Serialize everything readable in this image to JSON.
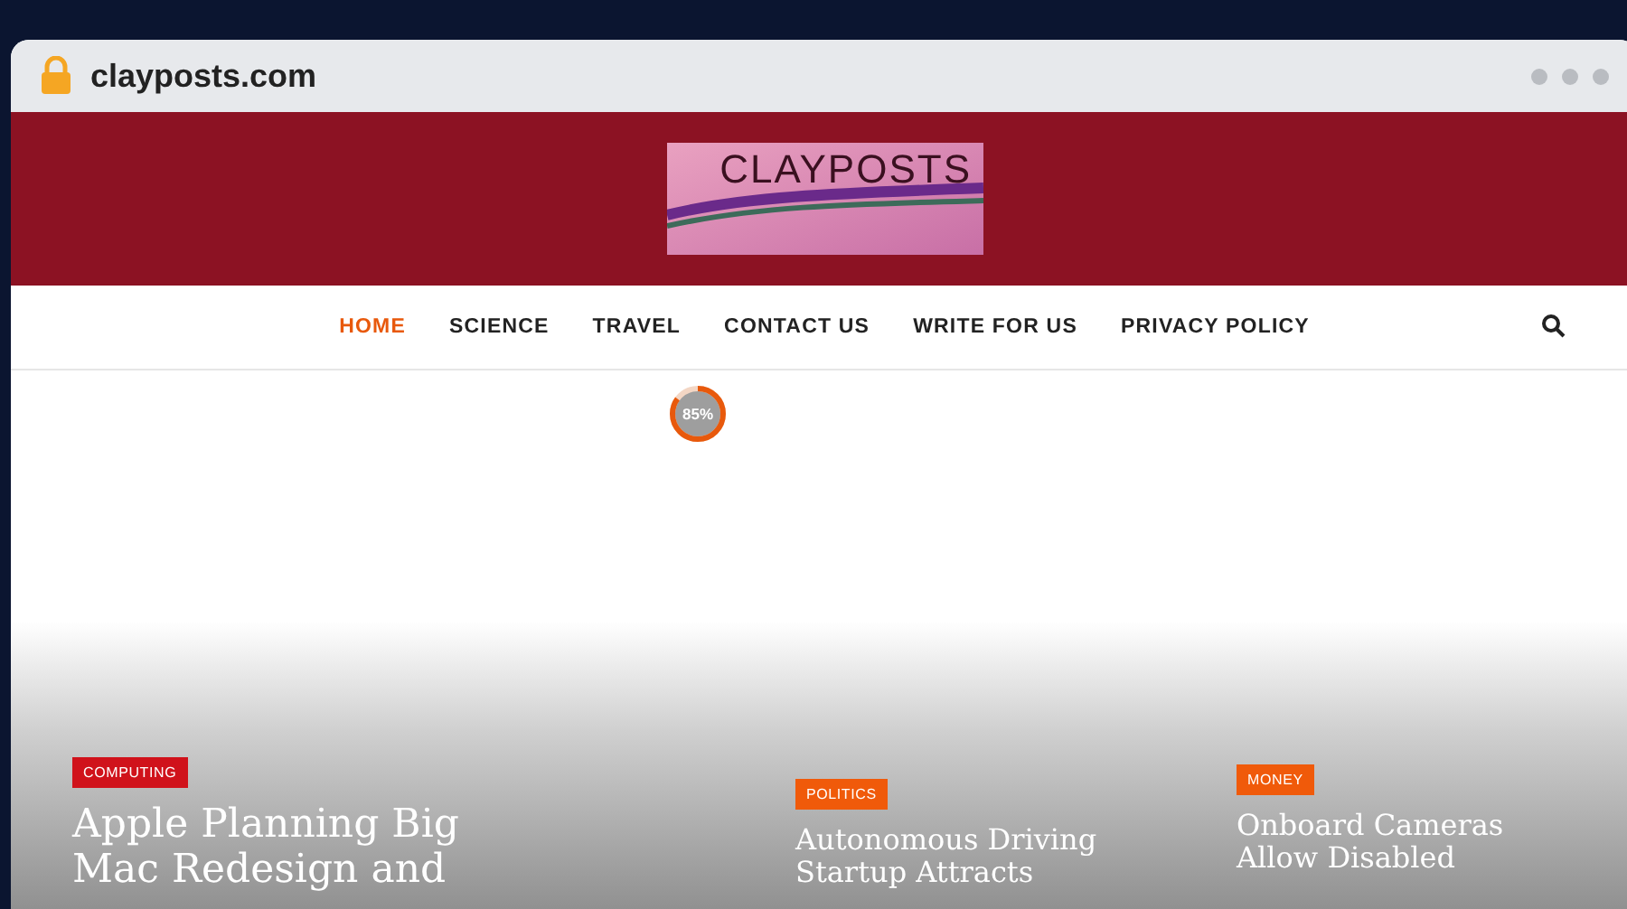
{
  "browser": {
    "address": "clayposts.com"
  },
  "header": {
    "logo_text": "CLAYPOSTS"
  },
  "nav": {
    "items": [
      {
        "label": "HOME",
        "selected": true
      },
      {
        "label": "SCIENCE",
        "selected": false
      },
      {
        "label": "TRAVEL",
        "selected": false
      },
      {
        "label": "CONTACT US",
        "selected": false
      },
      {
        "label": "WRITE FOR US",
        "selected": false
      },
      {
        "label": "PRIVACY POLICY",
        "selected": false
      }
    ]
  },
  "progress": {
    "reading": "85%",
    "level": 0.85
  },
  "posts": [
    {
      "category": "COMPUTING",
      "color": "#d0121b",
      "title": "Apple Planning Big Mac Redesign and"
    },
    {
      "category": "POLITICS",
      "color": "#f05a0a",
      "title": "Autonomous Driving Startup Attracts"
    },
    {
      "category": "MONEY",
      "color": "#f05a0a",
      "title": "Onboard Cameras Allow Disabled"
    }
  ]
}
